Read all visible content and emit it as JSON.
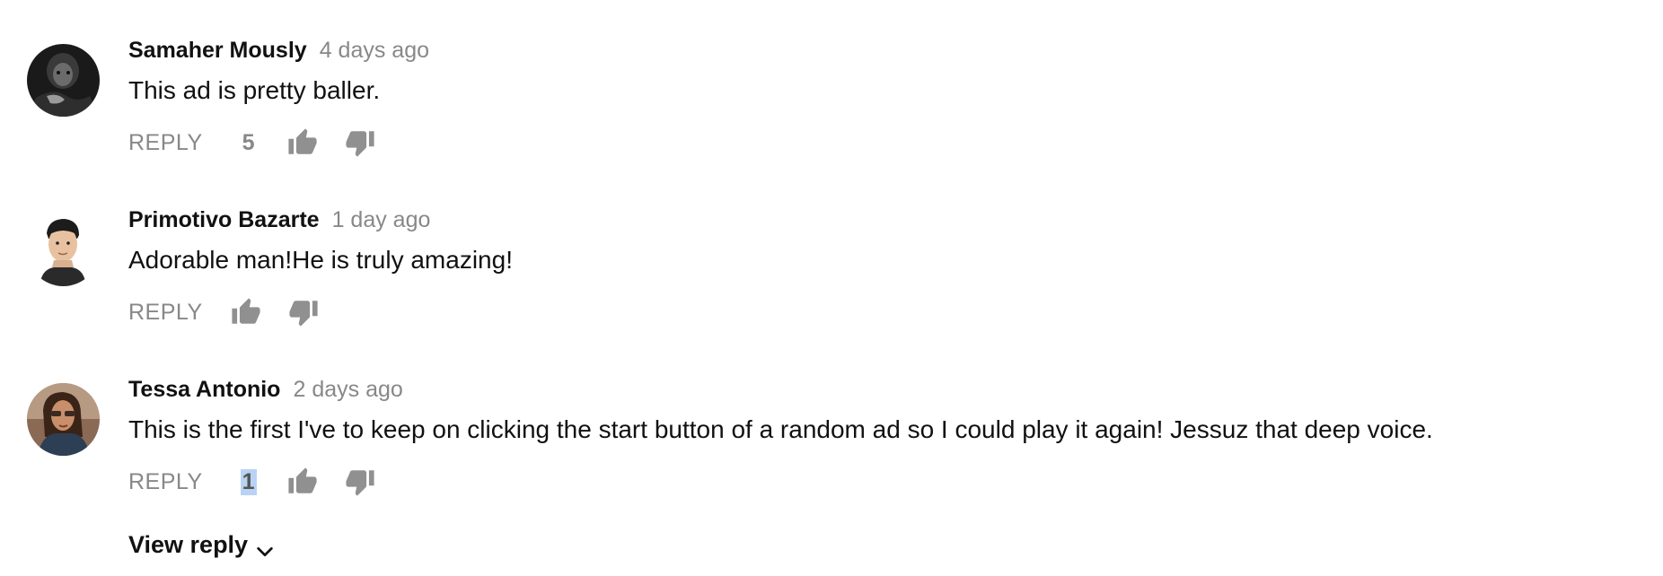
{
  "comments": [
    {
      "author": "Samaher Mously",
      "timestamp": "4 days ago",
      "text": "This ad is pretty baller.",
      "reply_label": "REPLY",
      "like_count": "5",
      "avatar_icon": "avatar-dark-portrait"
    },
    {
      "author": "Primotivo Bazarte",
      "timestamp": "1 day ago",
      "text": "Adorable man!He is truly amazing!",
      "reply_label": "REPLY",
      "like_count": "",
      "avatar_icon": "avatar-man-portrait"
    },
    {
      "author": "Tessa Antonio",
      "timestamp": "2 days ago",
      "text": "This is the first I've to keep on clicking the start button of a random ad so I could play it again! Jessuz that deep voice.",
      "reply_label": "REPLY",
      "like_count": "1",
      "avatar_icon": "avatar-woman-portrait"
    }
  ],
  "view_replies": {
    "label": "View reply",
    "icon": "chevron-down-icon"
  },
  "colors": {
    "author": "#111111",
    "meta": "#888888",
    "selection": "#b9d3f5"
  }
}
